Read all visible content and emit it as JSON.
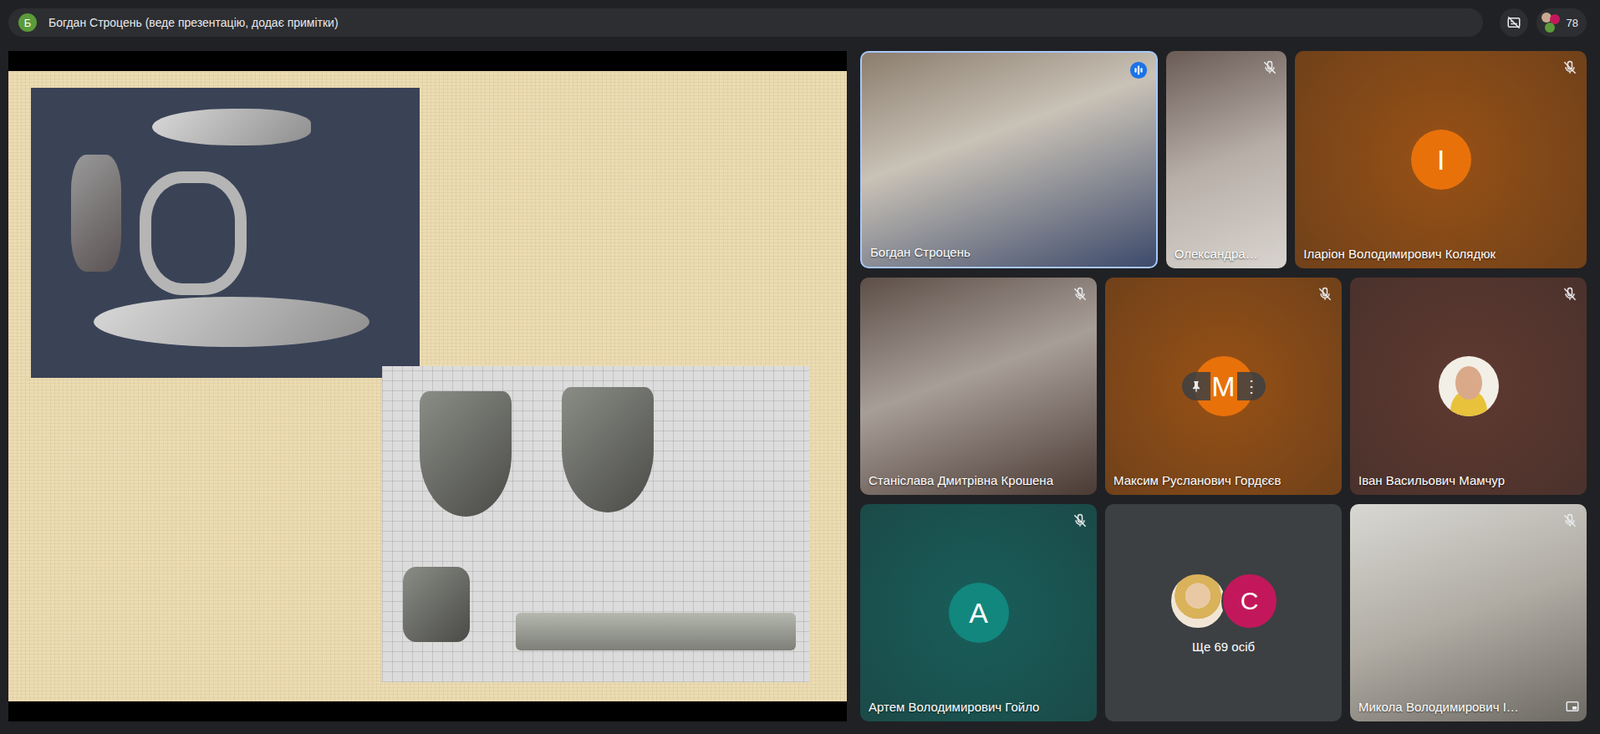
{
  "top_bar": {
    "presenter_initial": "Б",
    "title": "Богдан Строцень (веде презентацію, додає примітки)",
    "participants_count": "78"
  },
  "tile_rows": [
    [
      {
        "name": "Богдан Строцень",
        "kind": "video",
        "muted": false,
        "speaking": true
      },
      {
        "name": "Олександра…",
        "kind": "video",
        "muted": true,
        "speaking": false
      },
      {
        "name": "Іларіон Володимирович Колядюк",
        "kind": "letter",
        "initial": "І",
        "color": "#e8710a",
        "muted": true,
        "speaking": false
      }
    ],
    [
      {
        "name": "Станіслава Дмитрівна Крошена",
        "kind": "video",
        "muted": true,
        "speaking": false
      },
      {
        "name": "Максим Русланович Гордєєв",
        "kind": "letter",
        "initial": "М",
        "color": "#e8710a",
        "muted": true,
        "speaking": false,
        "hovered": true,
        "menu_glyph": "⋮"
      },
      {
        "name": "Іван Васильович Мамчур",
        "kind": "photo",
        "color": "#8a4a38",
        "muted": true,
        "speaking": false
      }
    ],
    [
      {
        "name": "Артем Володимирович Гойло",
        "kind": "letter",
        "initial": "А",
        "color": "#12877e",
        "muted": true,
        "speaking": false
      },
      {
        "name": "",
        "kind": "others",
        "label": "Ще 69 осіб",
        "initial": "С",
        "color": "#c2185b",
        "muted": false,
        "speaking": false
      },
      {
        "name": "Микола Володимирович І…",
        "kind": "video",
        "muted": true,
        "speaking": false,
        "pip": true
      }
    ]
  ]
}
